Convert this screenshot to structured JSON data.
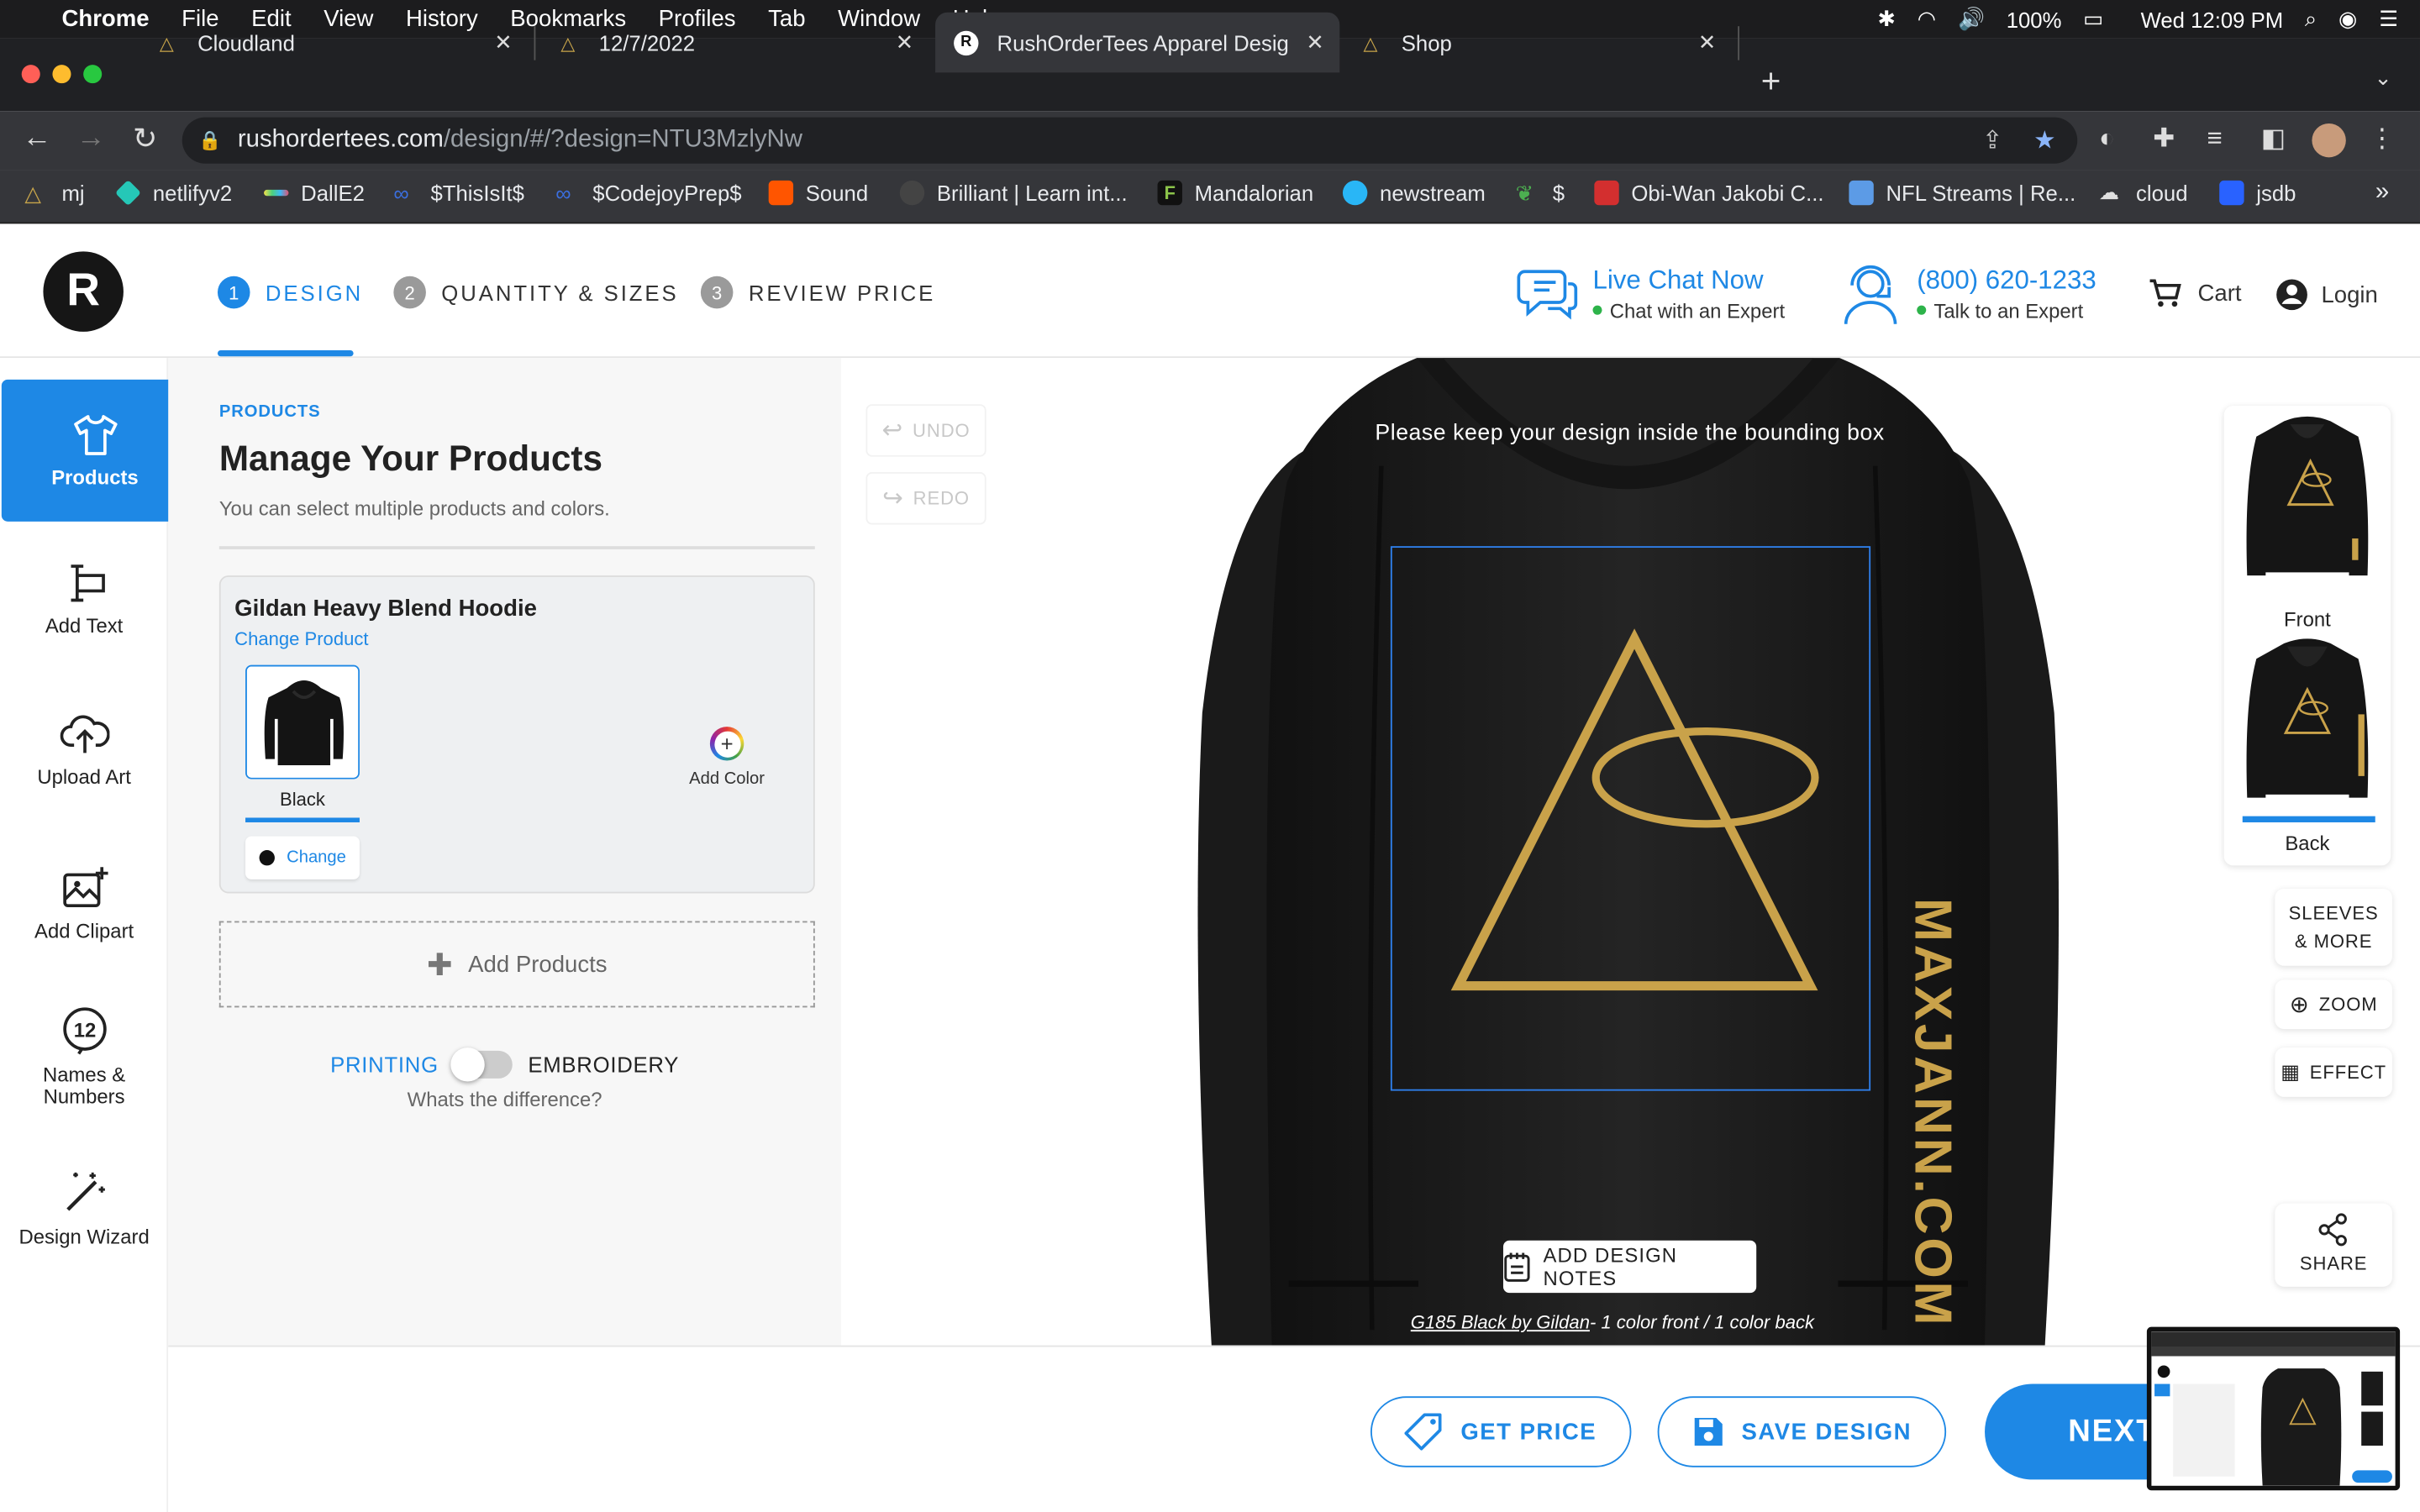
{
  "menubar": {
    "app": "Chrome",
    "items": [
      "File",
      "Edit",
      "View",
      "History",
      "Bookmarks",
      "Profiles",
      "Tab",
      "Window",
      "Help"
    ],
    "battery": "100%",
    "clock": "Wed 12:09 PM"
  },
  "tabs": [
    {
      "label": "Cloudland"
    },
    {
      "label": "12/7/2022"
    },
    {
      "label": "RushOrderTees Apparel Design"
    },
    {
      "label": "Shop"
    }
  ],
  "address": {
    "domain": "rushordertees.com",
    "path": "/design/#/?design=NTU3MzlyNw"
  },
  "bookmarks": [
    {
      "label": "mj",
      "color": "#c7a44a"
    },
    {
      "label": "netlifyv2",
      "color": "#25c7b7"
    },
    {
      "label": "DallE2",
      "color": "#e8e04f"
    },
    {
      "label": "$ThisIsIt$",
      "color": "#3b6fe0"
    },
    {
      "label": "$CodejoyPrep$",
      "color": "#3b6fe0"
    },
    {
      "label": "Sound",
      "color": "#ff5500"
    },
    {
      "label": "Brilliant | Learn int...",
      "color": "#444444"
    },
    {
      "label": "Mandalorian",
      "color": "#8bc34a"
    },
    {
      "label": "newstream",
      "color": "#29b6f6"
    },
    {
      "label": "$",
      "color": "#4caf50"
    },
    {
      "label": "Obi-Wan Jakobi C...",
      "color": "#d32f2f"
    },
    {
      "label": "NFL Streams | Re...",
      "color": "#5c9be6"
    },
    {
      "label": "cloud",
      "color": "#e0e0e0"
    },
    {
      "label": "jsdb",
      "color": "#2962ff"
    }
  ],
  "header": {
    "steps": [
      {
        "num": "1",
        "label": "DESIGN"
      },
      {
        "num": "2",
        "label": "QUANTITY & SIZES"
      },
      {
        "num": "3",
        "label": "REVIEW PRICE"
      }
    ],
    "chat_title": "Live Chat Now",
    "chat_sub": "Chat with an Expert",
    "phone_title": "(800) 620-1233",
    "phone_sub": "Talk to an Expert",
    "cart": "Cart",
    "login": "Login"
  },
  "rail": [
    {
      "label": "Products"
    },
    {
      "label": "Add Text"
    },
    {
      "label": "Upload Art"
    },
    {
      "label": "Add Clipart"
    },
    {
      "label": "Names &\nNumbers"
    },
    {
      "label": "Design Wizard"
    }
  ],
  "panel": {
    "eyebrow": "PRODUCTS",
    "title": "Manage Your Products",
    "subtitle": "You can select multiple products and colors.",
    "product_name": "Gildan Heavy Blend Hoodie",
    "change_product": "Change Product",
    "color_label": "Black",
    "change_color": "Change",
    "add_color": "Add Color",
    "add_products": "Add Products",
    "printing": "PRINTING",
    "embroidery": "EMBROIDERY",
    "difference": "Whats the difference?"
  },
  "canvas": {
    "undo": "UNDO",
    "redo": "REDO",
    "bbox_notice": "Please keep your design inside the bounding box",
    "sleeve_text": "MAXJANN.COM",
    "notes": "ADD DESIGN NOTES",
    "caption_link": "G185 Black by Gildan",
    "caption_rest": "- 1 color front  /  1 color back"
  },
  "views": {
    "front": "Front",
    "back": "Back",
    "sleeves": "SLEEVES\n& MORE",
    "zoom": "ZOOM",
    "effect": "EFFECT",
    "share": "SHARE"
  },
  "bottom": {
    "get_price": "GET PRICE",
    "save_design": "SAVE DESIGN",
    "next": "NEXT"
  },
  "colors": {
    "accent": "#1e88e5",
    "gold": "#c9a24a",
    "garment": "#1b1b1b"
  }
}
